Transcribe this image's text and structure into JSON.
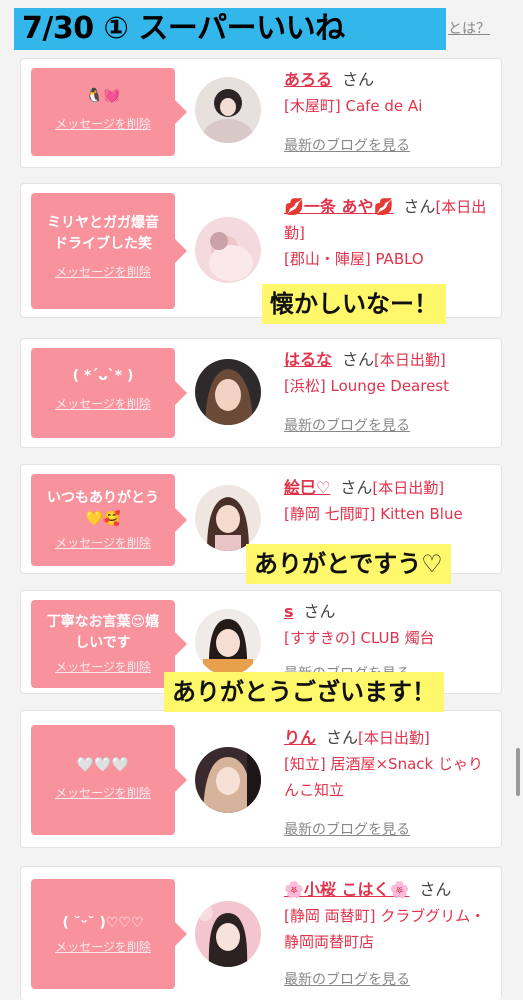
{
  "banner": {
    "title": "7/30 ① スーパーいいね",
    "whatis": "とは？"
  },
  "delete_label": "メッセージを削除",
  "blog_label": "最新のブログを見る",
  "san": "さん",
  "cards": [
    {
      "message": "🐧💓",
      "name": "あろる",
      "status": "",
      "shop": "[木屋町] Cafe de Ai",
      "blog": "最新のブログを見る"
    },
    {
      "message": "ミリヤとガガ爆音\nドライブした笑",
      "name": "💋一条 あや💋",
      "status": "[本日出勤]",
      "shop": "[郡山・陣屋] PABLO",
      "blog": ""
    },
    {
      "message": "( *´ᴗ`* )",
      "name": "はるな",
      "status": "[本日出勤]",
      "shop": "[浜松] Lounge Dearest",
      "blog": "最新のブログを見る"
    },
    {
      "message": "いつもありがとう\n💛🥰",
      "name": "絵巳♡",
      "status": "[本日出勤]",
      "shop": "[静岡 七間町] Kitten Blue",
      "blog": ""
    },
    {
      "message": "丁寧なお言葉😍嬉\nしいです",
      "name": "s",
      "status": "",
      "shop": "[すすきの] CLUB 燭台",
      "blog": "最新のブログを見る"
    },
    {
      "message": "🤍🤍🤍",
      "name": "りん",
      "status": "[本日出勤]",
      "shop": "[知立] 居酒屋×Snack じゃりんこ知立",
      "blog": "最新のブログを見る"
    },
    {
      "message": "( ˘ᵕ˘ )♡♡♡",
      "name": "🌸小桜 こはく🌸",
      "status": "",
      "shop": "[静岡 両替町] クラブグリム・静岡両替町店",
      "blog": "最新のブログを見る"
    }
  ],
  "overlays": {
    "one": "懐かしいなー！",
    "two": "ありがとですう♡",
    "three": "ありがとうございます！"
  },
  "colors": {
    "accent_pink": "#f8939e",
    "name_red": "#e0334c",
    "banner_blue": "#33b6ea",
    "highlight_yellow": "#fff86a"
  }
}
